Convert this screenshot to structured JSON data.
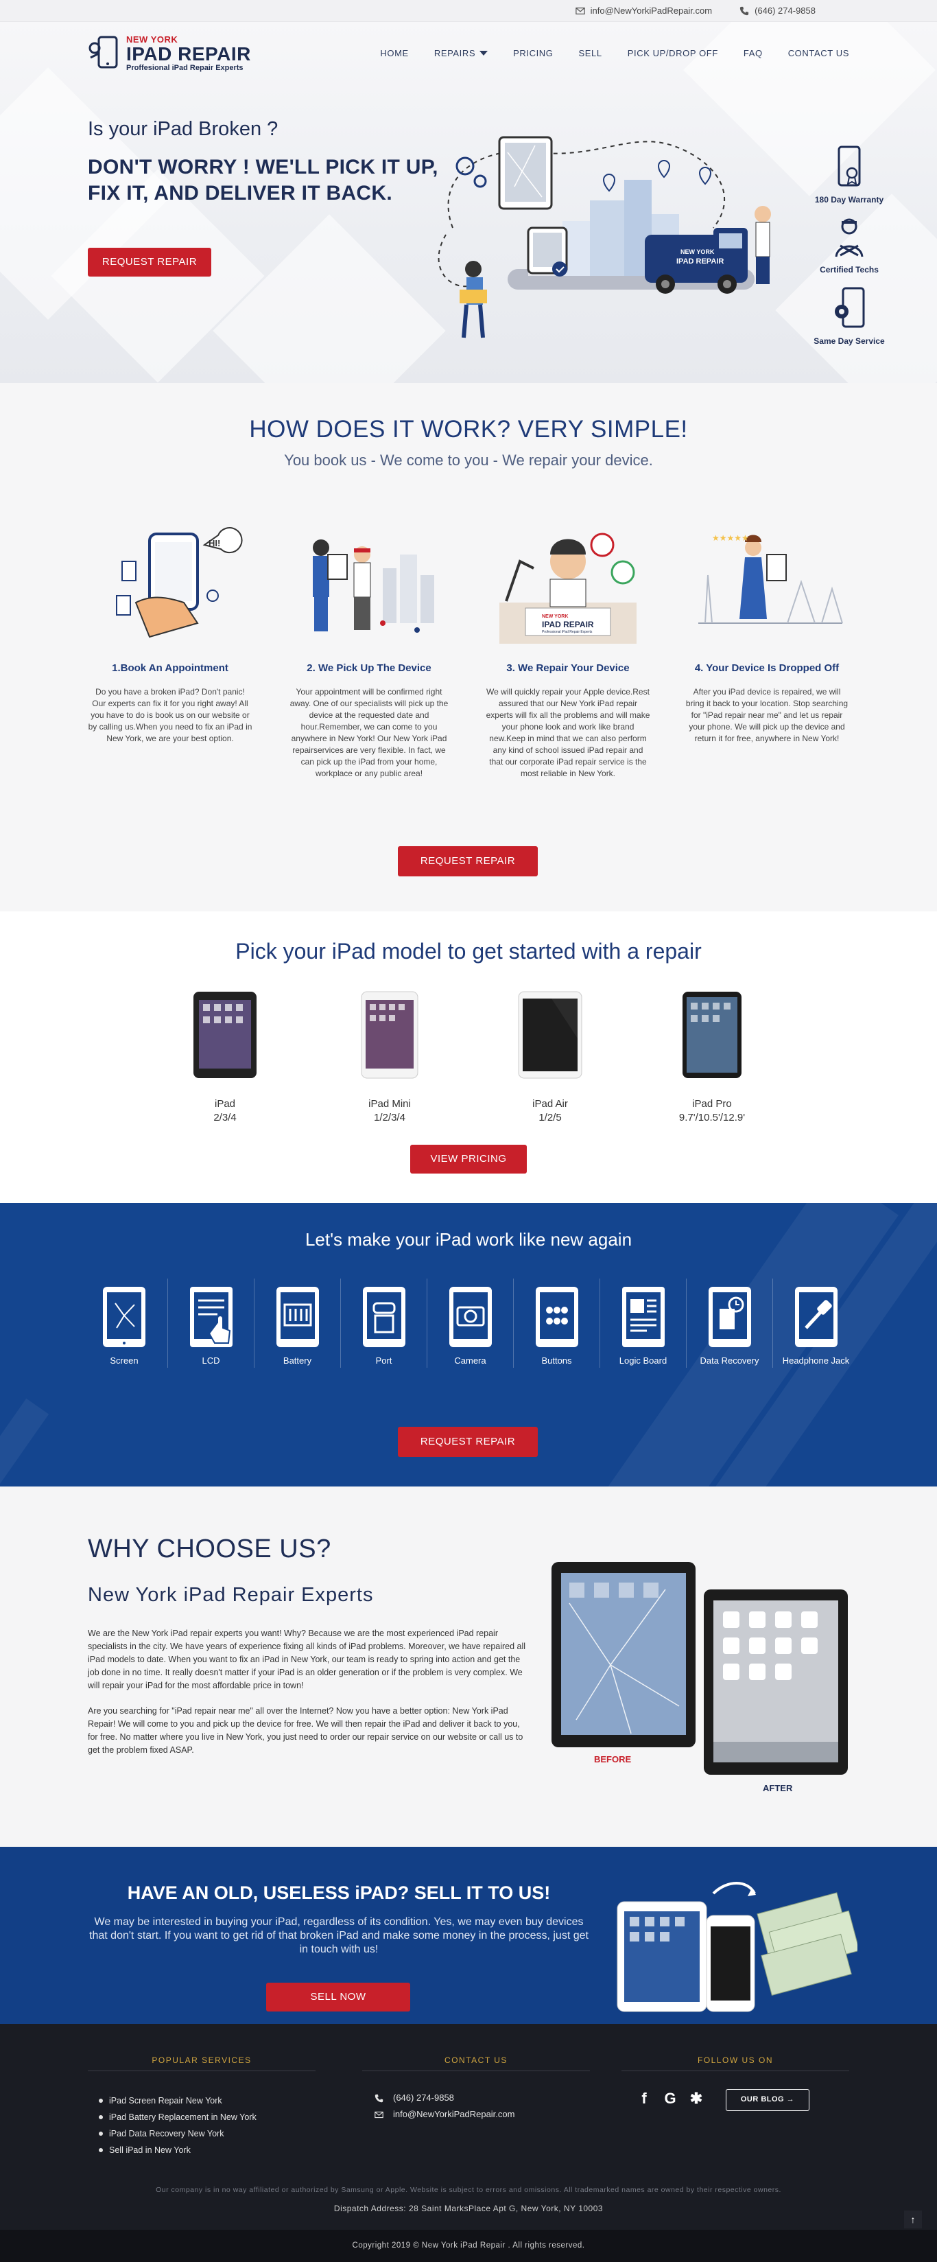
{
  "topbar": {
    "email": "info@NewYorkiPadRepair.com",
    "phone": "(646) 274-9858"
  },
  "brand": {
    "line1": "NEW YORK",
    "line2": "IPAD REPAIR",
    "line3": "Proffesional iPad Repair Experts"
  },
  "nav": [
    {
      "label": "HOME"
    },
    {
      "label": "REPAIRS"
    },
    {
      "label": "PRICING"
    },
    {
      "label": "SELL"
    },
    {
      "label": "PICK UP/DROP OFF"
    },
    {
      "label": "FAQ"
    },
    {
      "label": "CONTACT US"
    }
  ],
  "hero": {
    "question": "Is your iPad Broken ?",
    "headline": "DON'T WORRY ! WE'LL PICK IT UP, FIX IT, AND DELIVER IT BACK.",
    "button": "REQUEST REPAIR",
    "van_line1": "NEW YORK",
    "van_line2": "IPAD REPAIR",
    "features": [
      "180 Day Warranty",
      "Certified Techs",
      "Same Day Service"
    ]
  },
  "how": {
    "title": "HOW DOES IT WORK? VERY SIMPLE!",
    "subtitle": "You book us - We come to you - We repair your device.",
    "bubble": "HI!",
    "steps": [
      {
        "title": "1.Book An Appointment",
        "text": "Do you have a broken iPad? Don't panic! Our experts can fix it for you right away! All you have to do is book us on our website or by calling us.When you need to fix an iPad in New York, we are your best option."
      },
      {
        "title": "2. We Pick Up The Device",
        "text": "Your appointment will be confirmed right away. One of our specialists will pick up the device at the requested date and hour.Remember, we can come to you anywhere in New York! Our New York iPad repairservices are very flexible. In fact, we can pick up the iPad from your home, workplace or any public area!"
      },
      {
        "title": "3. We Repair Your Device",
        "text": "We will quickly repair your Apple device.Rest assured that our New York iPad repair experts will fix all the problems and will make your phone look and work like brand new.Keep in mind that we can also perform any kind of school issued iPad repair and that our corporate iPad repair service is the most reliable in New York."
      },
      {
        "title": "4. Your Device Is Dropped Off",
        "text": "After you iPad device is repaired, we will bring it back to your location. Stop searching for \"iPad repair near me\" and let us repair your phone. We will pick up the device and return it for free, anywhere in New York!"
      }
    ],
    "sign_small": "NEW YORK",
    "sign_big": "IPAD REPAIR",
    "sign_sub": "Professional iPad Repair Experts",
    "button": "REQUEST REPAIR"
  },
  "models": {
    "title": "Pick your iPad model to get started with a repair",
    "items": [
      {
        "name": "iPad",
        "sub": "2/3/4"
      },
      {
        "name": "iPad Mini",
        "sub": "1/2/3/4"
      },
      {
        "name": "iPad Air",
        "sub": "1/2/5"
      },
      {
        "name": "iPad Pro",
        "sub": "9.7'/10.5'/12.9'"
      }
    ],
    "button": "VIEW PRICING"
  },
  "services": {
    "title": "Let's make your iPad work like new again",
    "items": [
      "Screen",
      "LCD",
      "Battery",
      "Port",
      "Camera",
      "Buttons",
      "Logic Board",
      "Data Recovery",
      "Headphone Jack"
    ],
    "button": "REQUEST REPAIR"
  },
  "why": {
    "title": "WHY CHOOSE US?",
    "subtitle": "New York iPad Repair Experts",
    "p1": "We are the New York iPad repair experts you want! Why? Because we are the most experienced iPad repair specialists in the city. We have years of experience fixing all kinds of iPad problems. Moreover, we have repaired all iPad models to date. When you want to fix an iPad in New York, our team is ready to spring into action and get the job done in no time. It really doesn't matter if your iPad is an older generation or if the problem is very complex. We will repair your iPad for the most affordable price in town!",
    "p2": "Are you searching for \"iPad repair near me\" all over the Internet? Now you have a better option: New York iPad Repair! We will come to you and pick up the device for free. We will then repair the iPad and deliver it back to you, for free. No matter where you live in New York, you just need to order our repair service on our website or call us to get the problem fixed ASAP.",
    "before": "BEFORE",
    "after": "AFTER"
  },
  "sell": {
    "title": "HAVE AN OLD, USELESS iPAD? SELL IT TO US!",
    "text": "We may be interested in buying your iPad, regardless of its condition. Yes, we may even buy devices that don't start. If you want to get rid of that broken iPad and make some money in the process, just get in touch with us!",
    "button": "SELL NOW"
  },
  "footer": {
    "popular_title": "POPULAR SERVICES",
    "popular": [
      "iPad Screen Repair New York",
      "iPad Battery Replacement in New York",
      "iPad Data Recovery New York",
      "Sell iPad in New York"
    ],
    "contact_title": "CONTACT US",
    "phone": "(646) 274-9858",
    "email": "info@NewYorkiPadRepair.com",
    "follow_title": "FOLLOW US ON",
    "blog": "OUR BLOG",
    "disclaimer": "Our company is in no way affiliated or authorized by Samsung or Apple. Website is subject to errors and omissions. All trademarked names are owned by their respective owners.",
    "dispatch": "Dispatch Address: 28 Saint MarksPlace Apt G, New York, NY 10003",
    "copyright": "Copyright 2019 © New York iPad Repair . All rights reserved."
  },
  "colors": {
    "accent": "#c8202a",
    "navy": "#1e2d55",
    "blue": "#14458f",
    "footer": "#1a1c23"
  }
}
